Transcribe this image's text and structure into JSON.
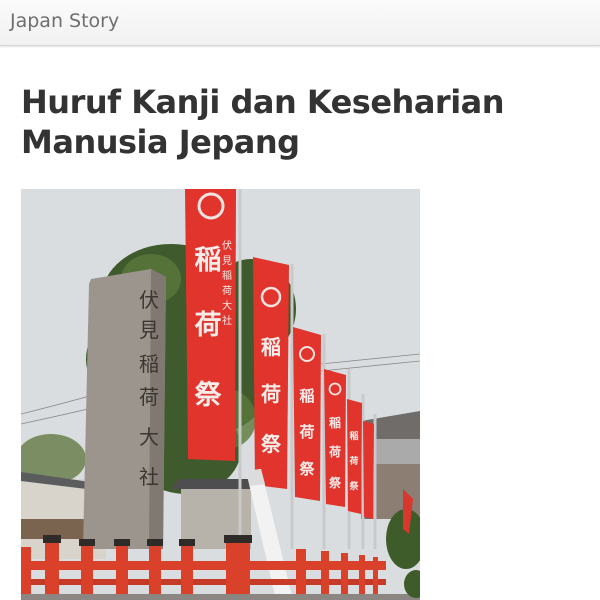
{
  "header": {
    "app_title": "Japan Story"
  },
  "article": {
    "title": "Huruf Kanji dan Keseharian Manusia Jepang"
  },
  "photo": {
    "stone_pillar_text": [
      "伏",
      "見",
      "稲",
      "荷",
      "大",
      "社"
    ],
    "banner_1_large_text": [
      "稲",
      "荷",
      "祭"
    ],
    "banner_1_small_text": [
      "伏",
      "見",
      "稲",
      "荷",
      "大",
      "社"
    ],
    "banner_text": [
      "稲",
      "荷",
      "祭"
    ],
    "colors": {
      "sky": "#d9dcdd",
      "banner_red": "#e0332b",
      "fence_red": "#d9412b",
      "stone": "#9b948c",
      "foliage": "#3f5a2c"
    }
  }
}
